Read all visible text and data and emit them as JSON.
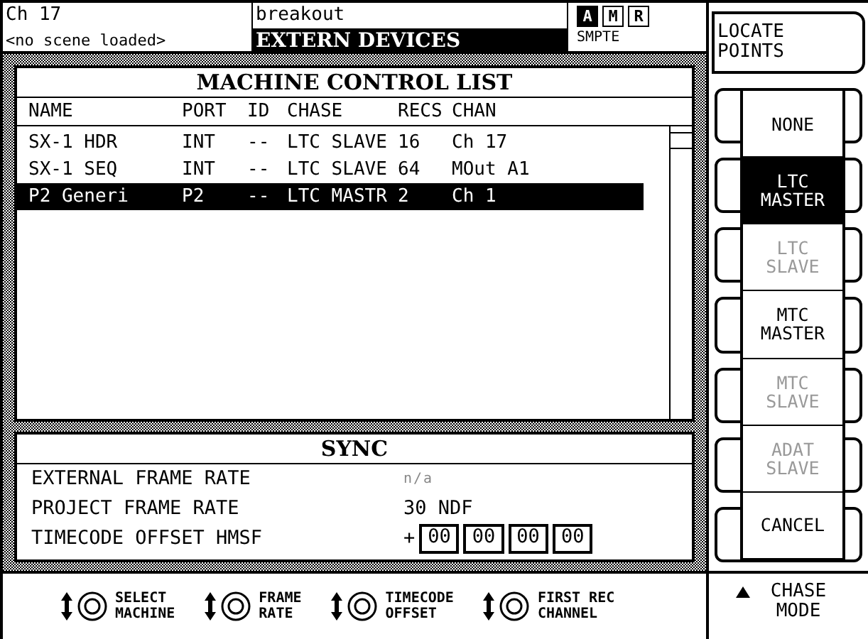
{
  "header": {
    "channel": "Ch 17",
    "scene": "<no scene loaded>",
    "project": "breakout",
    "page_title": "EXTERN DEVICES",
    "sync_source": "SMPTE",
    "indicators": [
      {
        "label": "A",
        "selected": true
      },
      {
        "label": "M",
        "selected": false
      },
      {
        "label": "R",
        "selected": false
      }
    ]
  },
  "locate_button": "LOCATE POINTS",
  "machine_list": {
    "title": "MACHINE CONTROL LIST",
    "columns": [
      "NAME",
      "PORT",
      "ID",
      "CHASE",
      "RECS",
      "CHAN"
    ],
    "rows": [
      {
        "cells": [
          "SX-1 HDR",
          "INT",
          "--",
          "LTC SLAVE",
          "16",
          "Ch 17"
        ],
        "selected": false
      },
      {
        "cells": [
          "SX-1 SEQ",
          "INT",
          "--",
          "LTC SLAVE",
          "64",
          "MOut A1"
        ],
        "selected": false
      },
      {
        "cells": [
          "P2 Generi",
          "P2",
          "--",
          "LTC MASTR",
          "2",
          "Ch 1"
        ],
        "selected": true
      }
    ]
  },
  "sync": {
    "title": "SYNC",
    "rows": [
      {
        "label": "EXTERNAL FRAME RATE",
        "value": "n/a",
        "disabled": true
      },
      {
        "label": "PROJECT FRAME RATE",
        "value": "30 NDF",
        "disabled": false
      }
    ],
    "offset": {
      "label": "TIMECODE OFFSET HMSF",
      "sign": "+",
      "fields": [
        "00",
        "00",
        "00",
        "00"
      ]
    }
  },
  "chase_menu": [
    {
      "label": "NONE",
      "selected": false,
      "disabled": false
    },
    {
      "label": "LTC MASTER",
      "selected": true,
      "disabled": false
    },
    {
      "label": "LTC SLAVE",
      "selected": false,
      "disabled": true
    },
    {
      "label": "MTC MASTER",
      "selected": false,
      "disabled": false
    },
    {
      "label": "MTC SLAVE",
      "selected": false,
      "disabled": true
    },
    {
      "label": "ADAT SLAVE",
      "selected": false,
      "disabled": true
    },
    {
      "label": "CANCEL",
      "selected": false,
      "disabled": false
    }
  ],
  "knobs": [
    {
      "line1": "SELECT",
      "line2": "MACHINE"
    },
    {
      "line1": "FRAME",
      "line2": "RATE"
    },
    {
      "line1": "TIMECODE",
      "line2": "OFFSET"
    },
    {
      "line1": "FIRST REC",
      "line2": "CHANNEL"
    }
  ],
  "chase_mode": "CHASE MODE"
}
